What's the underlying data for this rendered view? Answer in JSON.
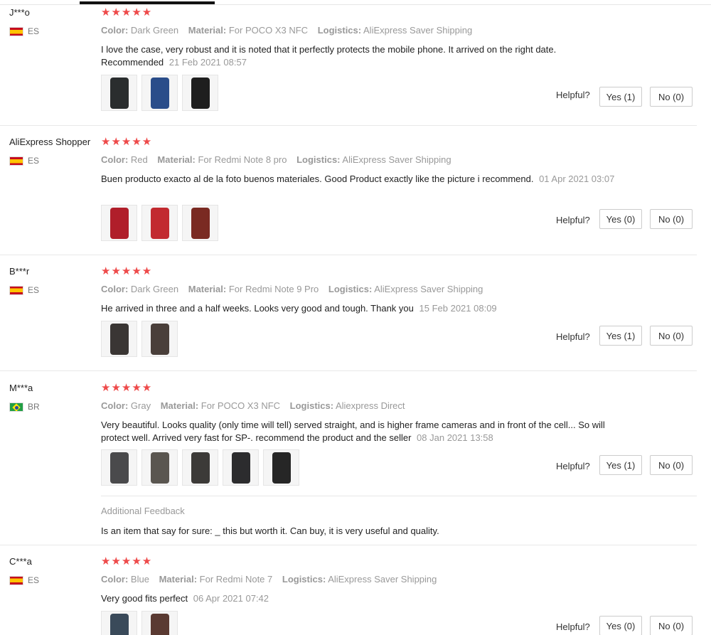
{
  "helpful_label": "Helpful?",
  "reviews": [
    {
      "user": "J***o",
      "country": "ES",
      "flag": "es",
      "stars": "★★★★★",
      "color_label": "Color:",
      "color": "Dark Green",
      "material_label": "Material:",
      "material": "For POCO X3 NFC",
      "logistics_label": "Logistics:",
      "logistics": "AliExpress Saver Shipping",
      "text": "I love the case, very robust and it is noted that it perfectly protects the mobile phone. It arrived on the right date. Recommended",
      "date": "21 Feb 2021 08:57",
      "photos": [
        "#2a2d2e",
        "#2a4d8a",
        "#1e1e1e"
      ],
      "yes": "Yes (1)",
      "no": "No (0)"
    },
    {
      "user": "AliExpress Shopper",
      "country": "ES",
      "flag": "es",
      "stars": "★★★★★",
      "color_label": "Color:",
      "color": "Red",
      "material_label": "Material:",
      "material": "For Redmi Note 8 pro",
      "logistics_label": "Logistics:",
      "logistics": "AliExpress Saver Shipping",
      "text": "Buen producto exacto al de la foto buenos materiales. Good Product exactly like the picture i recommend.",
      "date": "01 Apr 2021 03:07",
      "photos": [
        "#b01e2a",
        "#c22a30",
        "#7a2a22"
      ],
      "yes": "Yes (0)",
      "no": "No (0)"
    },
    {
      "user": "B***r",
      "country": "ES",
      "flag": "es",
      "stars": "★★★★★",
      "color_label": "Color:",
      "color": "Dark Green",
      "material_label": "Material:",
      "material": "For Redmi Note 9 Pro",
      "logistics_label": "Logistics:",
      "logistics": "AliExpress Saver Shipping",
      "text": "He arrived in three and a half weeks. Looks very good and tough. Thank you",
      "date": "15 Feb 2021 08:09",
      "photos": [
        "#3a3634",
        "#4a3f3a"
      ],
      "yes": "Yes (1)",
      "no": "No (0)"
    },
    {
      "user": "M***a",
      "country": "BR",
      "flag": "br",
      "stars": "★★★★★",
      "color_label": "Color:",
      "color": "Gray",
      "material_label": "Material:",
      "material": "For POCO X3 NFC",
      "logistics_label": "Logistics:",
      "logistics": "Aliexpress Direct",
      "text": "Very beautiful. Looks quality (only time will tell) served straight, and is higher frame cameras and in front of the cell... So will protect well. Arrived very fast for SP-. recommend the product and the seller",
      "date": "08 Jan 2021 13:58",
      "photos": [
        "#4a4a4c",
        "#5a5650",
        "#3c3a38",
        "#2c2c2e",
        "#262626"
      ],
      "yes": "Yes (1)",
      "no": "No (0)",
      "additional_title": "Additional Feedback",
      "additional_text": "Is an item that say for sure: _ this but worth it. Can buy, it is very useful and quality."
    },
    {
      "user": "C***a",
      "country": "ES",
      "flag": "es",
      "stars": "★★★★★",
      "color_label": "Color:",
      "color": "Blue",
      "material_label": "Material:",
      "material": "For Redmi Note 7",
      "logistics_label": "Logistics:",
      "logistics": "AliExpress Saver Shipping",
      "text": "Very good fits perfect",
      "date": "06 Apr 2021 07:42",
      "photos": [
        "#3a4a5a",
        "#5a3a32"
      ],
      "yes": "Yes (0)",
      "no": "No (0)"
    }
  ]
}
